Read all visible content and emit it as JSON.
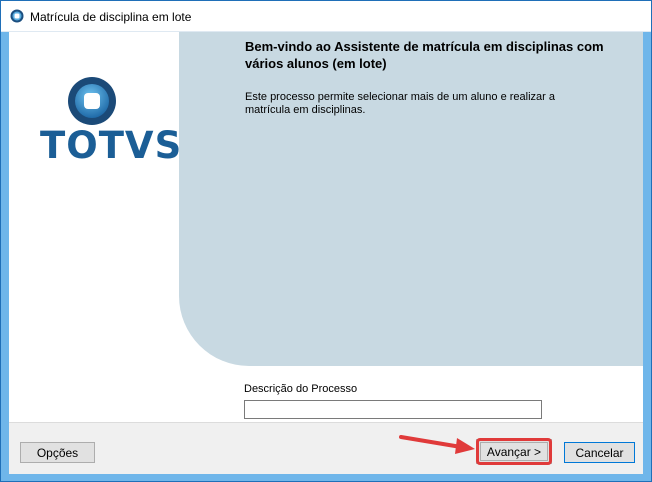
{
  "window": {
    "title": "Matrícula de disciplina em lote"
  },
  "logo": {
    "text": "TOTVS",
    "colors": {
      "primary": "#1b5e96",
      "ball_light": "#4aa3d8"
    }
  },
  "welcome": {
    "title": "Bem-vindo ao Assistente de matrícula em disciplinas com vários alunos (em lote)",
    "description": "Este processo permite selecionar mais de um aluno e realizar a matrícula em disciplinas."
  },
  "process": {
    "label": "Descrição do Processo",
    "value": ""
  },
  "footer": {
    "options_label": "Opções",
    "next_label": "Avançar >",
    "cancel_label": "Cancelar"
  },
  "annotation": {
    "color": "#e03a3a",
    "target": "next-button"
  }
}
